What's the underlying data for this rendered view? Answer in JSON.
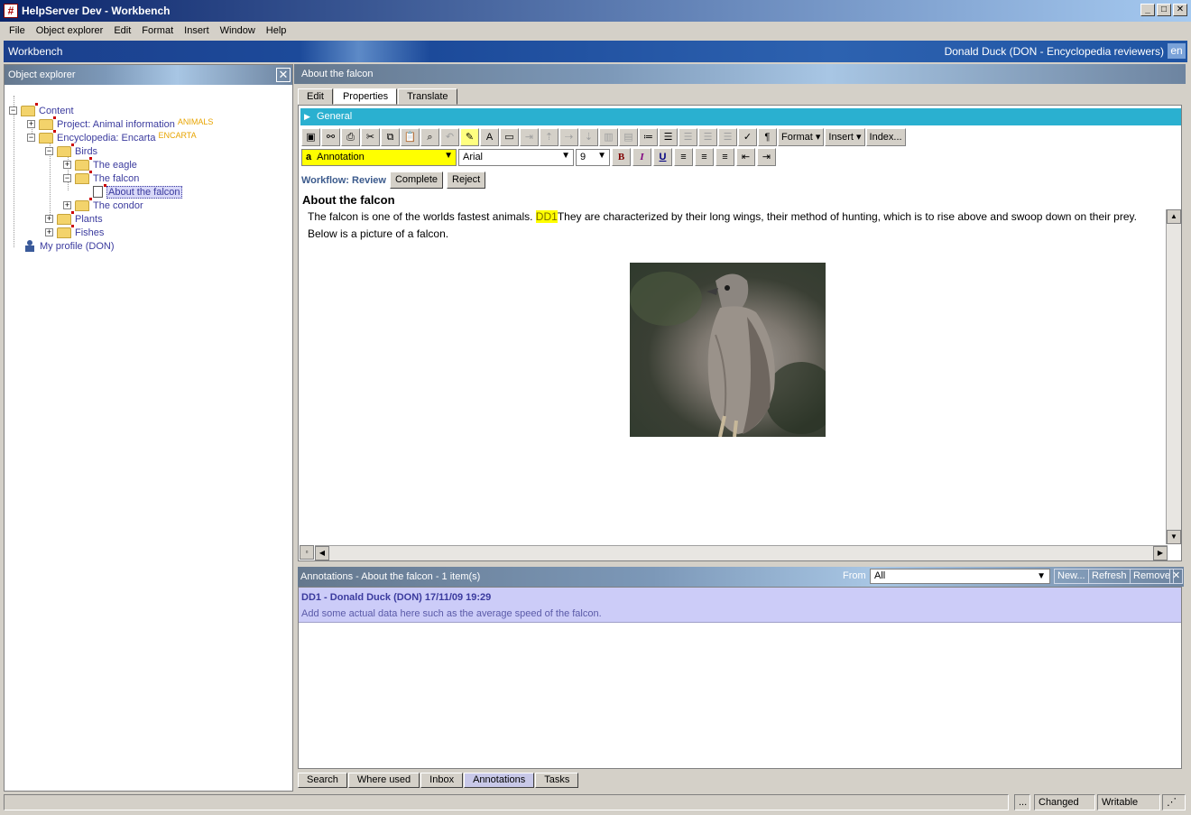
{
  "window": {
    "title": "HelpServer Dev - Workbench",
    "app_icon": "#"
  },
  "menu": [
    "File",
    "Object explorer",
    "Edit",
    "Format",
    "Insert",
    "Window",
    "Help"
  ],
  "workbench": {
    "label": "Workbench",
    "user": "Donald Duck (DON - Encyclopedia reviewers)",
    "lang": "en"
  },
  "explorer": {
    "title": "Object explorer",
    "tree": {
      "content": "Content",
      "project": "Project: Animal information",
      "project_badge": "ANIMALS",
      "encyclopedia": "Encyclopedia: Encarta",
      "encyclopedia_badge": "ENCARTA",
      "birds": "Birds",
      "eagle": "The eagle",
      "falcon": "The falcon",
      "about_falcon": "About the falcon",
      "condor": "The condor",
      "plants": "Plants",
      "fishes": "Fishes",
      "profile": "My profile (DON)"
    }
  },
  "document": {
    "header": "About the falcon",
    "tabs": [
      "Edit",
      "Properties",
      "Translate"
    ],
    "section": "General",
    "toolbar": {
      "format": "Format",
      "insert": "Insert",
      "index": "Index..."
    },
    "style_combo": "Annotation",
    "font_combo": "Arial",
    "size_combo": "9",
    "workflow": {
      "label": "Workflow: Review",
      "complete": "Complete",
      "reject": "Reject"
    },
    "title": "About the falcon",
    "para1_before": "The falcon is one of the worlds fastest animals. ",
    "para1_mark": "DD1",
    "para1_after": "They are characterized by their long wings, their method of hunting, which is to rise above and swoop down on their prey.",
    "para2": "Below is a picture of a falcon."
  },
  "annotations": {
    "header": "Annotations - About the falcon - 1 item(s)",
    "from_label": "From",
    "from_value": "All",
    "buttons": {
      "new": "New...",
      "refresh": "Refresh",
      "remove": "Remove"
    },
    "items": [
      {
        "heading": "DD1 - Donald Duck (DON) 17/11/09 19:29",
        "text": "Add some actual data here such as the average speed of the falcon."
      }
    ]
  },
  "bottom_tabs": [
    "Search",
    "Where used",
    "Inbox",
    "Annotations",
    "Tasks"
  ],
  "status": {
    "ellipsis": "...",
    "changed": "Changed",
    "writable": "Writable"
  }
}
